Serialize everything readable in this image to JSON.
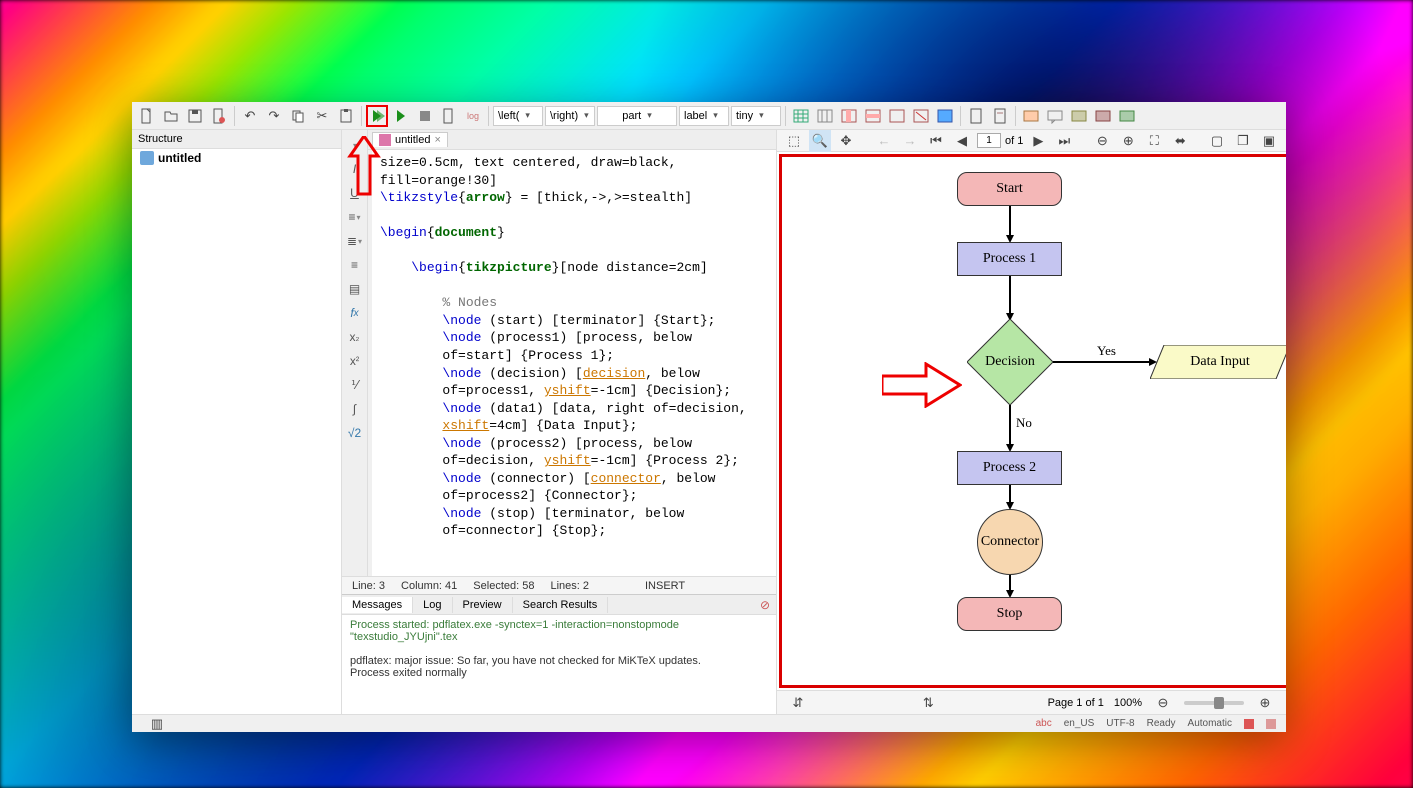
{
  "toolbar": {
    "dropdowns": {
      "left": "\\left(",
      "right": "\\right)",
      "part": "part",
      "label": "label",
      "size": "tiny"
    }
  },
  "sidebar": {
    "header": "Structure",
    "items": [
      {
        "label": "untitled"
      }
    ]
  },
  "tabs": [
    {
      "label": "untitled"
    }
  ],
  "code": {
    "l1a": "size=0.5cm, text centered, draw=black,",
    "l1b": "fill=orange!30]",
    "l2_cmd": "\\tikzstyle",
    "l2_arg": "arrow",
    "l2_rest": " = [thick,->,>=stealth]",
    "l3_cmd": "\\begin",
    "l3_arg": "document",
    "l4_cmd": "\\begin",
    "l4_arg": "tikzpicture",
    "l4_rest": "[node distance=2cm]",
    "l5": "% Nodes",
    "l6_cmd": "\\node",
    "l6_rest": " (start) [terminator] {Start};",
    "l7_cmd": "\\node",
    "l7_rest": " (process1) [process, below",
    "l7b": "of=start] {Process 1};",
    "l8_cmd": "\\node",
    "l8_a": " (decision) [",
    "l8_id": "decision",
    "l8_b": ", below",
    "l8c_a": "of=process1, ",
    "l8c_id": "yshift",
    "l8c_b": "=-1cm] {Decision};",
    "l9_cmd": "\\node",
    "l9_rest": " (data1) [data, right of=decision,",
    "l9b_id": "xshift",
    "l9b_rest": "=4cm] {Data Input};",
    "l10_cmd": "\\node",
    "l10_rest": " (process2) [process, below",
    "l10b_a": "of=decision, ",
    "l10b_id": "yshift",
    "l10b_b": "=-1cm] {Process 2};",
    "l11_cmd": "\\node",
    "l11_a": " (connector) [",
    "l11_id": "connector",
    "l11_b": ", below",
    "l11c": "of=process2] {Connector};",
    "l12_cmd": "\\node",
    "l12_rest": " (stop) [terminator, below",
    "l12b": "of=connector] {Stop};"
  },
  "statusbar": {
    "line": "Line: 3",
    "col": "Column: 41",
    "sel": "Selected: 58",
    "lines": "Lines: 2",
    "mode": "INSERT"
  },
  "messages": {
    "tabs": [
      "Messages",
      "Log",
      "Preview",
      "Search Results"
    ],
    "line1": "Process started: pdflatex.exe -synctex=1 -interaction=nonstopmode \"texstudio_JYUjni\".tex",
    "line2": "pdflatex: major issue: So far, you have not checked for MiKTeX updates.",
    "line3": "Process exited normally"
  },
  "preview": {
    "page_current": "1",
    "page_of": "of 1",
    "pagefoot": "Page 1 of 1",
    "zoom": "100%",
    "nodes": {
      "start": "Start",
      "p1": "Process 1",
      "dec": "Decision",
      "data": "Data Input",
      "p2": "Process 2",
      "conn": "Connector",
      "stop": "Stop"
    },
    "edge_yes": "Yes",
    "edge_no": "No"
  },
  "footer": {
    "lang": "en_US",
    "enc": "UTF-8",
    "state": "Ready",
    "auto": "Automatic"
  },
  "chart_data": {
    "type": "diagram-flowchart",
    "nodes": [
      {
        "id": "start",
        "shape": "terminator",
        "label": "Start",
        "fill": "#f4b7b7"
      },
      {
        "id": "p1",
        "shape": "process",
        "label": "Process 1",
        "fill": "#c5c5f0"
      },
      {
        "id": "dec",
        "shape": "decision",
        "label": "Decision",
        "fill": "#b6e6a5"
      },
      {
        "id": "data",
        "shape": "data",
        "label": "Data Input",
        "fill": "#fafac8"
      },
      {
        "id": "p2",
        "shape": "process",
        "label": "Process 2",
        "fill": "#c5c5f0"
      },
      {
        "id": "conn",
        "shape": "connector",
        "label": "Connector",
        "fill": "#f7d7b0"
      },
      {
        "id": "stop",
        "shape": "terminator",
        "label": "Stop",
        "fill": "#f4b7b7"
      }
    ],
    "edges": [
      {
        "from": "start",
        "to": "p1"
      },
      {
        "from": "p1",
        "to": "dec"
      },
      {
        "from": "dec",
        "to": "data",
        "label": "Yes"
      },
      {
        "from": "dec",
        "to": "p2",
        "label": "No"
      },
      {
        "from": "p2",
        "to": "conn"
      },
      {
        "from": "conn",
        "to": "stop"
      }
    ]
  }
}
